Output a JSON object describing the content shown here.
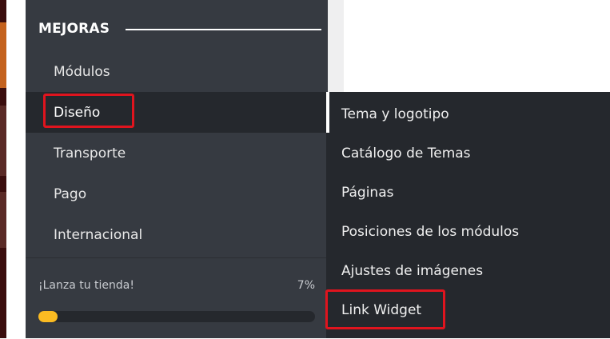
{
  "sidebar": {
    "section_title": "MEJORAS",
    "items": [
      {
        "label": "Módulos"
      },
      {
        "label": "Diseño"
      },
      {
        "label": "Transporte"
      },
      {
        "label": "Pago"
      },
      {
        "label": "Internacional"
      }
    ],
    "active_item": "Diseño",
    "launch": {
      "label": "¡Lanza tu tienda!",
      "percent_text": "7%",
      "progress": 0.07
    }
  },
  "submenu": {
    "items": [
      {
        "label": "Tema y logotipo"
      },
      {
        "label": "Catálogo de Temas"
      },
      {
        "label": "Páginas"
      },
      {
        "label": "Posiciones de los módulos"
      },
      {
        "label": "Ajustes de imágenes"
      },
      {
        "label": "Link Widget"
      }
    ]
  },
  "colors": {
    "sidebar_bg": "#363a41",
    "active_bg": "#25282d",
    "highlight": "#e0141e",
    "progress": "#fbbb22"
  }
}
